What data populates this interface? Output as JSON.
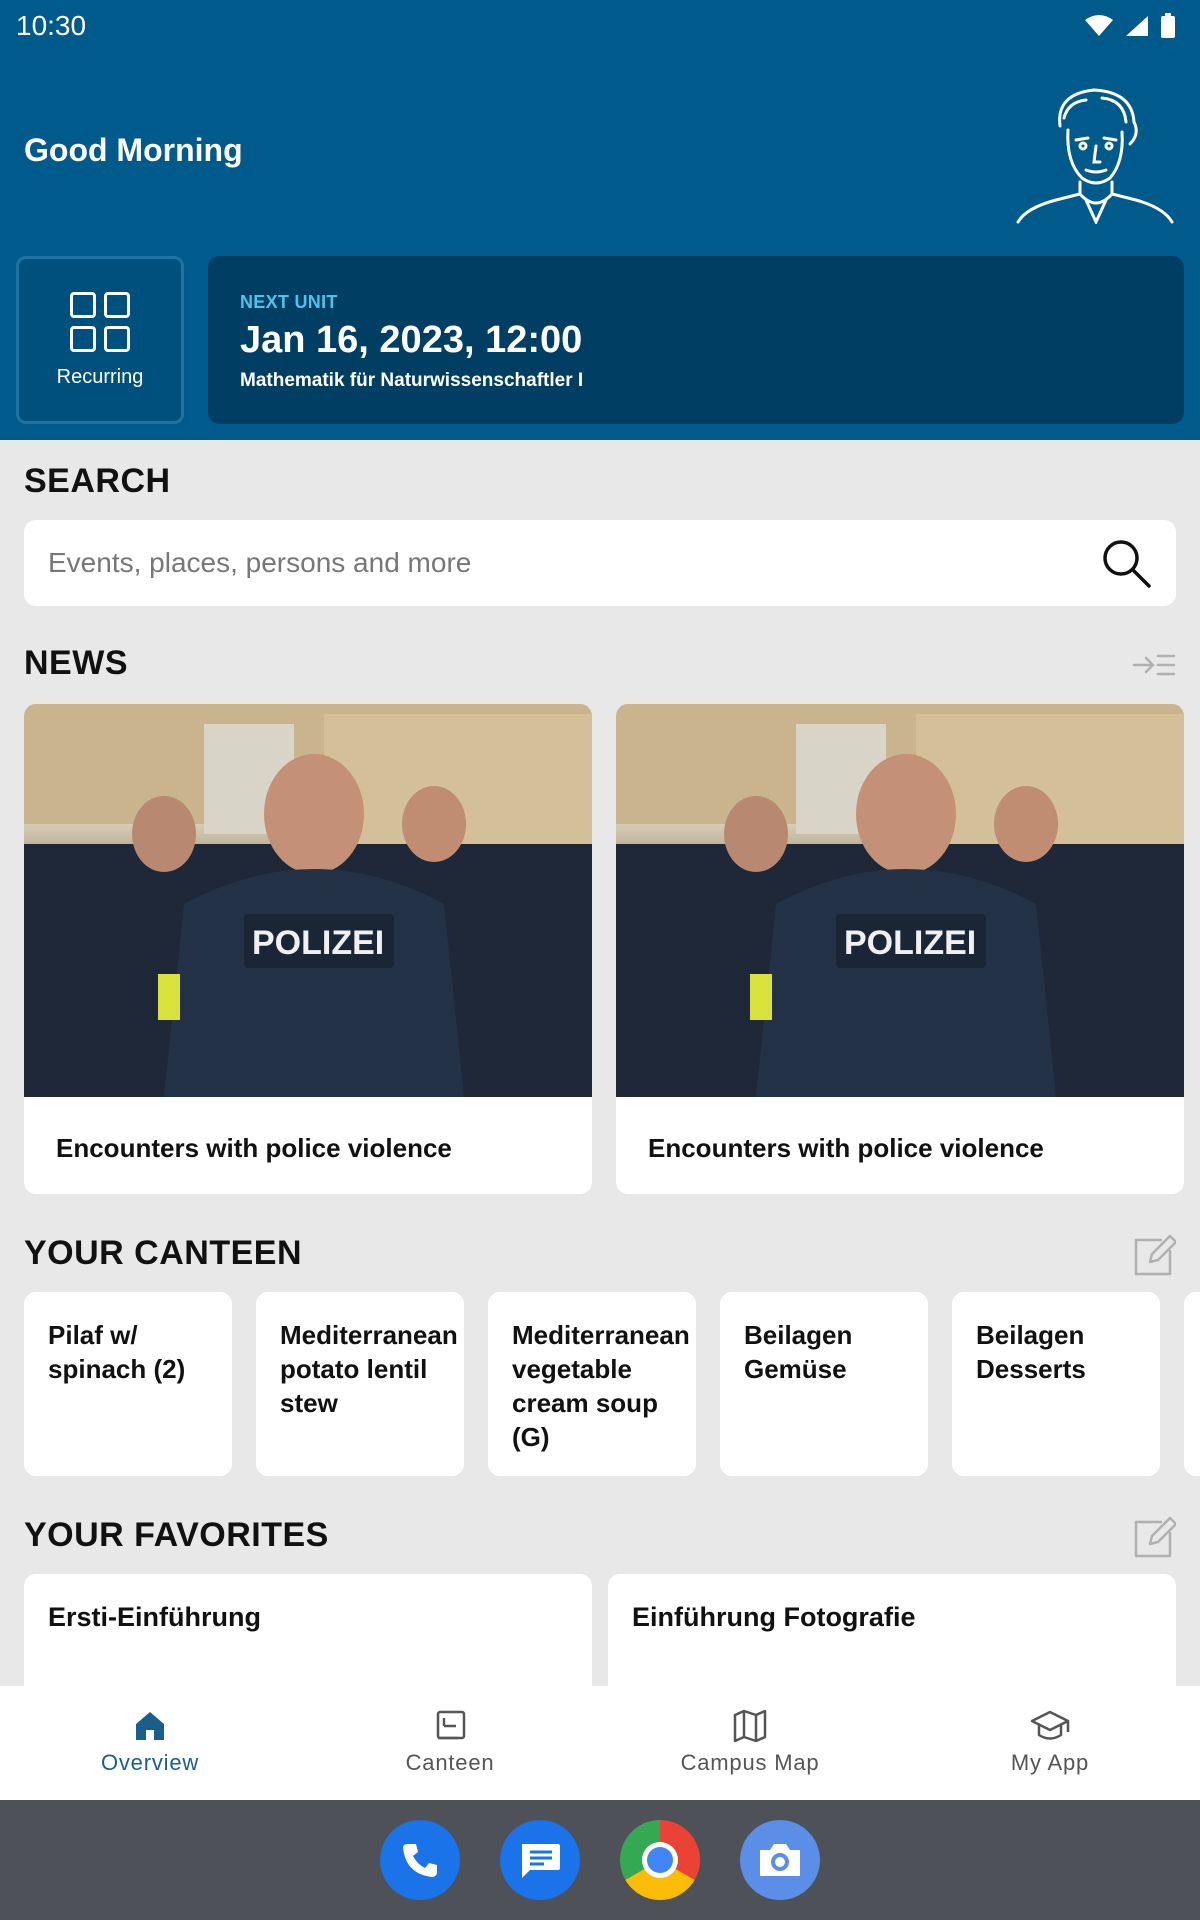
{
  "status_bar": {
    "time": "10:30"
  },
  "header": {
    "greeting": "Good Morning",
    "recurring_label": "Recurring",
    "next_unit": {
      "tag": "NEXT UNIT",
      "datetime": "Jan 16, 2023, 12:00",
      "course": "Mathematik für Naturwissenschaftler I"
    }
  },
  "search": {
    "title": "SEARCH",
    "placeholder": "Events, places, persons and more"
  },
  "news": {
    "title": "NEWS",
    "items": [
      {
        "title": "Encounters with police violence",
        "image_text": "POLIZEI"
      },
      {
        "title": "Encounters with police violence",
        "image_text": "POLIZEI"
      }
    ]
  },
  "canteen": {
    "title": "YOUR CANTEEN",
    "items": [
      {
        "label": "Pilaf w/ spinach (2)"
      },
      {
        "label": "Mediterranean potato lentil stew"
      },
      {
        "label": "Mediterranean vegetable cream soup (G)"
      },
      {
        "label": "Beilagen Gemüse"
      },
      {
        "label": "Beilagen Desserts"
      }
    ]
  },
  "favorites": {
    "title": "YOUR FAVORITES",
    "items": [
      {
        "label": "Ersti-Einführung"
      },
      {
        "label": "Einführung Fotografie"
      }
    ]
  },
  "bottom_nav": {
    "items": [
      {
        "label": "Overview",
        "icon": "home-icon",
        "active": true
      },
      {
        "label": "Canteen",
        "icon": "cup-icon",
        "active": false
      },
      {
        "label": "Campus Map",
        "icon": "map-icon",
        "active": false
      },
      {
        "label": "My App",
        "icon": "graduation-cap-icon",
        "active": false
      }
    ]
  },
  "dock": {
    "apps": [
      "phone-icon",
      "messages-icon",
      "chrome-icon",
      "camera-icon"
    ]
  },
  "colors": {
    "header_bg": "#005a8c",
    "next_unit_bg": "#003f63",
    "accent_cyan": "#4ec3ee",
    "active_nav": "#1a5f8c"
  }
}
